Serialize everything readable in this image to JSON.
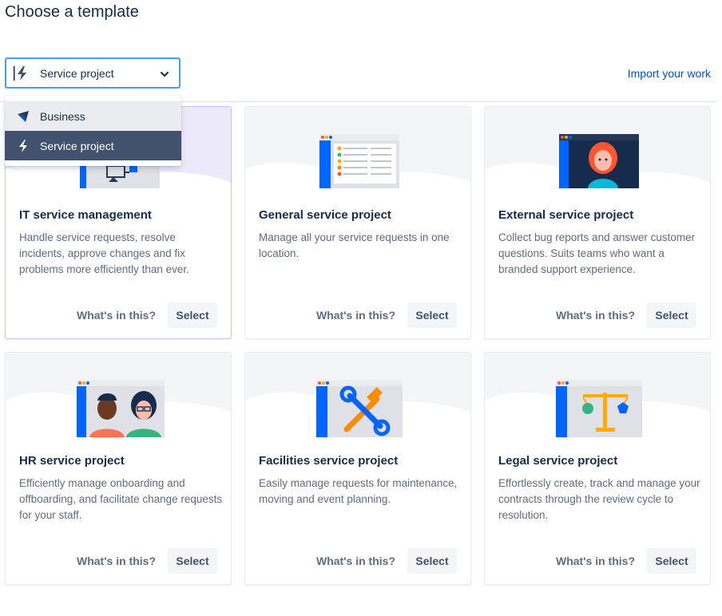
{
  "page": {
    "title": "Choose a template"
  },
  "selector": {
    "value": "Service project",
    "icon": "service-project-bolt-icon"
  },
  "import_link": "Import your work",
  "dropdown": {
    "options": [
      {
        "label": "Business",
        "icon": "business-flag-icon",
        "state": "hover"
      },
      {
        "label": "Service project",
        "icon": "service-project-bolt-icon",
        "state": "selected"
      }
    ]
  },
  "cards": [
    {
      "title": "IT service management",
      "description": "Handle service requests, resolve incidents, approve changes and fix problems more efficiently than ever.",
      "whats_label": "What's in this?",
      "select_label": "Select",
      "illustration": "it-service-illustration"
    },
    {
      "title": "General service project",
      "description": "Manage all your service requests in one location.",
      "whats_label": "What's in this?",
      "select_label": "Select",
      "illustration": "general-service-illustration"
    },
    {
      "title": "External service project",
      "description": "Collect bug reports and answer customer questions. Suits teams who want a branded support experience.",
      "whats_label": "What's in this?",
      "select_label": "Select",
      "illustration": "external-service-illustration"
    },
    {
      "title": "HR service project",
      "description": "Efficiently manage onboarding and offboarding, and facilitate change requests for your staff.",
      "whats_label": "What's in this?",
      "select_label": "Select",
      "illustration": "hr-service-illustration"
    },
    {
      "title": "Facilities service project",
      "description": "Easily manage requests for maintenance, moving and event planning.",
      "whats_label": "What's in this?",
      "select_label": "Select",
      "illustration": "facilities-service-illustration"
    },
    {
      "title": "Legal service project",
      "description": "Effortlessly create, track and manage your contracts through the review cycle to resolution.",
      "whats_label": "What's in this?",
      "select_label": "Select",
      "illustration": "legal-service-illustration"
    }
  ],
  "colors": {
    "accent": "#0052cc",
    "focus_border": "#4c9aff",
    "selected_item": "#42526e",
    "text": "#172b4d",
    "muted_text": "#5e6c84"
  }
}
